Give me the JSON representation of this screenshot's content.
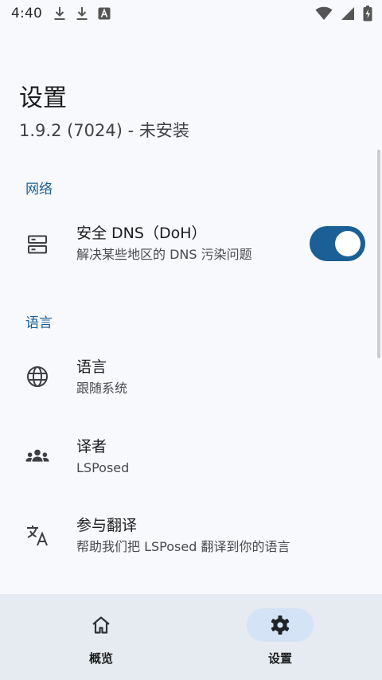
{
  "status_bar": {
    "time": "4:40",
    "left_icons": [
      "download-icon",
      "download-icon",
      "font-icon"
    ],
    "right_icons": [
      "wifi-icon",
      "signal-icon",
      "battery-charging-icon"
    ]
  },
  "header": {
    "title": "设置",
    "subtitle": "1.9.2 (7024) - 未安装"
  },
  "sections": {
    "network": {
      "header": "网络",
      "items": [
        {
          "icon": "dns-server-icon",
          "title": "安全 DNS（DoH）",
          "summary": "解决某些地区的 DNS 污染问题",
          "toggle_on": true
        }
      ]
    },
    "language": {
      "header": "语言",
      "items": [
        {
          "icon": "globe-icon",
          "title": "语言",
          "summary": "跟随系统"
        },
        {
          "icon": "group-icon",
          "title": "译者",
          "summary": "LSPosed"
        },
        {
          "icon": "translate-icon",
          "title": "参与翻译",
          "summary": "帮助我们把 LSPosed 翻译到你的语言"
        }
      ]
    }
  },
  "bottom_nav": {
    "items": [
      {
        "icon": "home-icon",
        "label": "概览",
        "active": false
      },
      {
        "icon": "gear-icon",
        "label": "设置",
        "active": true
      }
    ]
  },
  "colors": {
    "accent": "#1a5f95",
    "nav_background": "#e6ebf1",
    "nav_active_indicator": "#d4e3f5",
    "background": "#f8f9fc"
  }
}
